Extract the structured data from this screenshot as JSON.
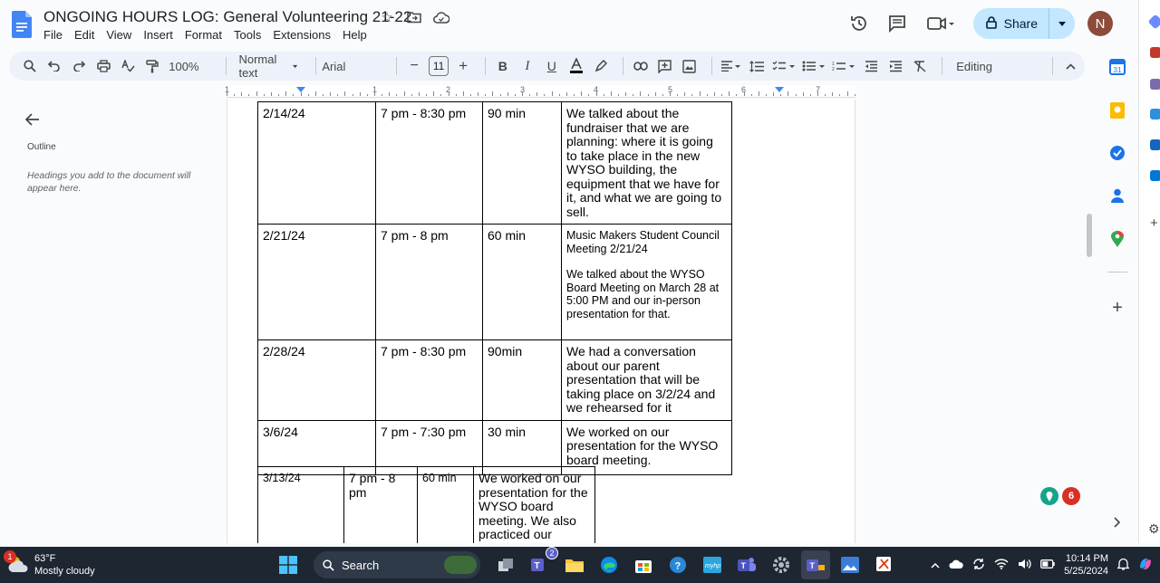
{
  "doc": {
    "title": "ONGOING HOURS LOG: General Volunteering 21-22",
    "menus": [
      "File",
      "Edit",
      "View",
      "Insert",
      "Format",
      "Tools",
      "Extensions",
      "Help"
    ]
  },
  "header": {
    "share_label": "Share",
    "avatar_initial": "N"
  },
  "toolbar": {
    "zoom": "100%",
    "style": "Normal text",
    "font": "Arial",
    "font_size": "11",
    "mode": "Editing",
    "minus": "−",
    "plus": "+"
  },
  "ruler": {
    "labels": [
      "1",
      "1",
      "2",
      "3",
      "4",
      "5",
      "6",
      "7"
    ]
  },
  "outline": {
    "label": "Outline",
    "hint": "Headings you add to the document will appear here."
  },
  "table1": {
    "rows": [
      {
        "date": "2/14/24",
        "time": "7 pm - 8:30 pm",
        "duration": "90 min",
        "notes": "We talked about the fundraiser that we are planning: where it is going to take place in the new WYSO building, the equipment that we have for it, and what we are going to sell."
      },
      {
        "date": "2/21/24",
        "time": "7 pm - 8 pm",
        "duration": "60 min",
        "notes_title": "Music Makers Student Council Meeting 2/21/24",
        "notes": "We talked about the WYSO Board Meeting on March 28 at 5:00 PM and our in-person presentation for that."
      },
      {
        "date": "2/28/24",
        "time": "7 pm - 8:30 pm",
        "duration": "90min",
        "notes": "We had a conversation about our parent presentation that will be taking place on 3/2/24 and we rehearsed for it"
      },
      {
        "date": "3/6/24",
        "time": "7 pm - 7:30 pm",
        "duration": "30 min",
        "notes": "We worked on our presentation for the WYSO board meeting."
      }
    ]
  },
  "table2": {
    "rows": [
      {
        "date": "3/13/24",
        "time": "7 pm - 8 pm",
        "duration": "60 min",
        "notes": "We worked on our presentation for the WYSO board meeting. We also practiced our"
      }
    ]
  },
  "taskbar": {
    "weather_temp": "63°F",
    "weather_desc": "Mostly cloudy",
    "weather_badge": "1",
    "search_label": "Search",
    "teams_badge": "2",
    "time": "10:14 PM",
    "date": "5/25/2024"
  },
  "floating": {
    "badge_count": "6"
  },
  "colors": {
    "accent": "#0b57d0",
    "share_bg": "#c2e7ff",
    "toolbar_bg": "#edf2fa",
    "taskbar_bg": "#1e2632"
  }
}
